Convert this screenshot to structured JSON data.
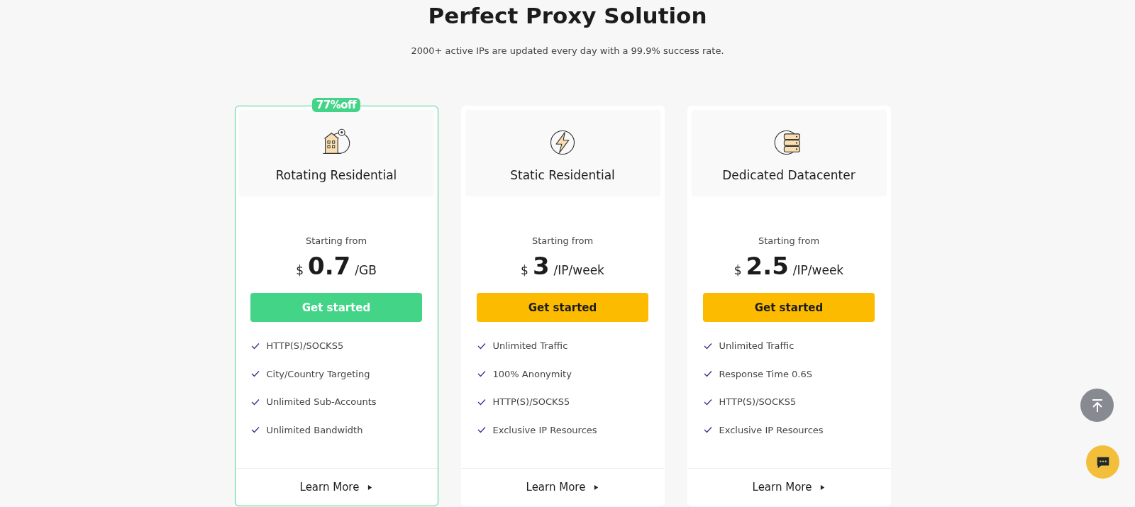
{
  "title": "Perfect Proxy Solution",
  "subtitle": "2000+ active IPs are updated every day with a 99.9% success rate.",
  "plans": [
    {
      "name": "Rotating Residential",
      "kind": "building",
      "featured": true,
      "badge": "77%off",
      "starting": "Starting from",
      "currency": "$",
      "price": "0.7",
      "unit": "/GB",
      "button": "Get started",
      "features": [
        "HTTP(S)/SOCKS5",
        "City/Country Targeting",
        "Unlimited Sub-Accounts",
        "Unlimited Bandwidth"
      ],
      "learn_more": "Learn More"
    },
    {
      "name": "Static Residential",
      "kind": "bolt",
      "featured": false,
      "starting": "Starting from",
      "currency": "$",
      "price": "3",
      "unit": "/IP/week",
      "button": "Get started",
      "features": [
        "Unlimited Traffic",
        "100% Anonymity",
        "HTTP(S)/SOCKS5",
        "Exclusive IP Resources"
      ],
      "learn_more": "Learn More"
    },
    {
      "name": "Dedicated Datacenter",
      "kind": "server",
      "featured": false,
      "starting": "Starting from",
      "currency": "$",
      "price": "2.5",
      "unit": "/IP/week",
      "button": "Get started",
      "features": [
        "Unlimited Traffic",
        "Response Time 0.6S",
        "HTTP(S)/SOCKS5",
        "Exclusive IP Resources"
      ],
      "learn_more": "Learn More"
    }
  ]
}
